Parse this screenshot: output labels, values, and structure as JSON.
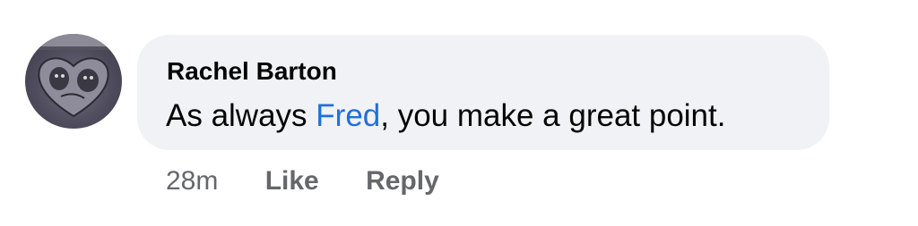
{
  "comment": {
    "author": "Rachel Barton",
    "text_prefix": "As always ",
    "mention": "Fred",
    "text_suffix": ", you make a great point.",
    "colors": {
      "bubble_bg": "#f0f2f5",
      "mention": "#216fdb",
      "meta_text": "#65676b",
      "text": "#050505"
    }
  },
  "actions": {
    "timestamp": "28m",
    "like_label": "Like",
    "reply_label": "Reply"
  },
  "avatar": {
    "icon": "profile-photo-dogs-heart"
  }
}
